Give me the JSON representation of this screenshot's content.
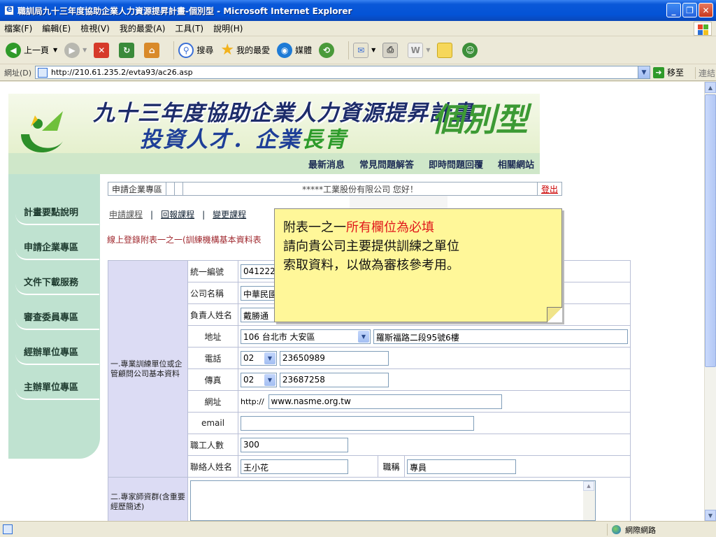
{
  "window": {
    "title": "職訓局九十三年度協助企業人力資源提昇計畫-個別型 - Microsoft Internet Explorer",
    "controls": [
      "minimize",
      "maximize",
      "close"
    ]
  },
  "menu": [
    "檔案(F)",
    "編輯(E)",
    "檢視(V)",
    "我的最愛(A)",
    "工具(T)",
    "說明(H)"
  ],
  "toolbar": {
    "back_label": "上一頁",
    "search_label": "搜尋",
    "favorites_label": "我的最愛",
    "media_label": "媒體"
  },
  "address": {
    "label": "網址(D)",
    "url": "http://210.61.235.2/evta93/ac26.asp",
    "go_label": "移至",
    "links_label": "連結"
  },
  "status": {
    "zone": "網際網路"
  },
  "banner": {
    "title_line1": "九十三年度協助企業人力資源提昇計畫-",
    "title_line2_a": "投資人才．企業",
    "title_line2_b": "長青",
    "type": "個別型"
  },
  "topnav": [
    "最新消息",
    "常見問題解答",
    "即時問題回覆",
    "相關網站"
  ],
  "sidebar": [
    "計畫要點說明",
    "申請企業專區",
    "文件下載服務",
    "審查委員專區",
    "經辦單位專區",
    "主辦單位專區"
  ],
  "userbar": {
    "area": "申請企業專區",
    "greeting": "*****工業股份有限公司 您好！",
    "logout": "登出"
  },
  "tabs": [
    "申請課程",
    "回報課程",
    "變更課程"
  ],
  "subtitle": "線上登錄附表一之一(訓練機構基本資料表",
  "form": {
    "section1": "一.專業訓練單位或企管顧問公司基本資料",
    "section2": "二.專家師資群(含重要經歷簡述)",
    "labels": {
      "tax_id": "統一編號",
      "company": "公司名稱",
      "owner": "負責人姓名",
      "address": "地址",
      "phone": "電話",
      "fax": "傳真",
      "website": "網址",
      "email": "email",
      "staff": "職工人數",
      "contact": "聯絡人姓名",
      "title": "職稱"
    },
    "values": {
      "tax_id": "0412220",
      "company": "中華民國",
      "owner": "戴勝通",
      "zip_city": "106 台北市 大安區",
      "street": "羅斯福路二段95號6樓",
      "phone_area": "02",
      "phone": "23650989",
      "fax_area": "02",
      "fax": "23687258",
      "url_prefix": "http://",
      "website": "www.nasme.org.tw",
      "email": "",
      "staff": "300",
      "contact": "王小花",
      "title": "專員"
    }
  },
  "callout": {
    "prefix": "附表一之一",
    "highlight": "所有欄位為必填",
    "line2": "請向貴公司主要提供訓練之單位",
    "line3": "索取資料，以做為審核參考用。"
  }
}
